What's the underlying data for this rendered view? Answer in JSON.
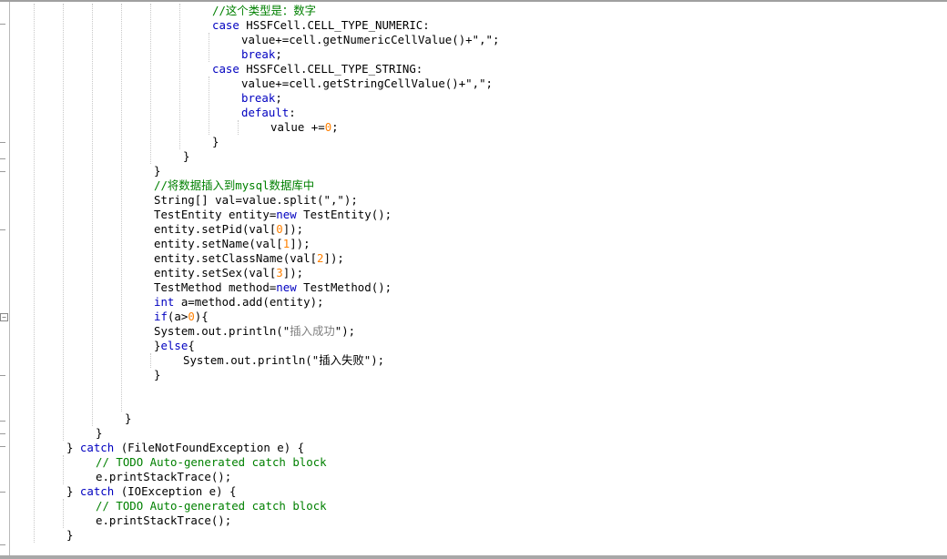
{
  "editor": {
    "lines": [
      {
        "indent": 7,
        "tokens": [
          {
            "t": "//这个类型是：数字",
            "c": "cm"
          }
        ]
      },
      {
        "indent": 7,
        "tokens": [
          {
            "t": "case",
            "c": "kw"
          },
          {
            "t": " HSSFCell.CELL_TYPE_NUMERIC:",
            "c": ""
          }
        ]
      },
      {
        "indent": 8,
        "tokens": [
          {
            "t": "value+=cell.getNumericCellValue()+\",\";",
            "c": ""
          }
        ]
      },
      {
        "indent": 8,
        "tokens": [
          {
            "t": "break",
            "c": "kw"
          },
          {
            "t": ";",
            "c": ""
          }
        ]
      },
      {
        "indent": 7,
        "tokens": [
          {
            "t": "case",
            "c": "kw"
          },
          {
            "t": " HSSFCell.CELL_TYPE_STRING:",
            "c": ""
          }
        ]
      },
      {
        "indent": 8,
        "tokens": [
          {
            "t": "value+=cell.getStringCellValue()+\",\";",
            "c": ""
          }
        ]
      },
      {
        "indent": 8,
        "tokens": [
          {
            "t": "break",
            "c": "kw"
          },
          {
            "t": ";",
            "c": ""
          }
        ]
      },
      {
        "indent": 8,
        "tokens": [
          {
            "t": "default",
            "c": "kw"
          },
          {
            "t": ":",
            "c": ""
          }
        ]
      },
      {
        "indent": 9,
        "tokens": [
          {
            "t": "value +=",
            "c": ""
          },
          {
            "t": "0",
            "c": "num"
          },
          {
            "t": ";",
            "c": ""
          }
        ]
      },
      {
        "indent": 7,
        "tokens": [
          {
            "t": "}",
            "c": ""
          }
        ]
      },
      {
        "indent": 6,
        "tokens": [
          {
            "t": "}",
            "c": ""
          }
        ]
      },
      {
        "indent": 5,
        "tokens": [
          {
            "t": "}",
            "c": ""
          }
        ]
      },
      {
        "indent": 5,
        "tokens": [
          {
            "t": "//将数据插入到mysql数据库中",
            "c": "cm"
          }
        ]
      },
      {
        "indent": 5,
        "tokens": [
          {
            "t": "String[] val=value.split(\",\");",
            "c": ""
          }
        ]
      },
      {
        "indent": 5,
        "tokens": [
          {
            "t": "TestEntity entity=",
            "c": ""
          },
          {
            "t": "new",
            "c": "kw"
          },
          {
            "t": " TestEntity();",
            "c": ""
          }
        ]
      },
      {
        "indent": 5,
        "tokens": [
          {
            "t": "entity.setPid(val[",
            "c": ""
          },
          {
            "t": "0",
            "c": "num"
          },
          {
            "t": "]);",
            "c": ""
          }
        ]
      },
      {
        "indent": 5,
        "tokens": [
          {
            "t": "entity.setName(val[",
            "c": ""
          },
          {
            "t": "1",
            "c": "num"
          },
          {
            "t": "]);",
            "c": ""
          }
        ]
      },
      {
        "indent": 5,
        "tokens": [
          {
            "t": "entity.setClassName(val[",
            "c": ""
          },
          {
            "t": "2",
            "c": "num"
          },
          {
            "t": "]);",
            "c": ""
          }
        ]
      },
      {
        "indent": 5,
        "tokens": [
          {
            "t": "entity.setSex(val[",
            "c": ""
          },
          {
            "t": "3",
            "c": "num"
          },
          {
            "t": "]);",
            "c": ""
          }
        ]
      },
      {
        "indent": 5,
        "tokens": [
          {
            "t": "TestMethod method=",
            "c": ""
          },
          {
            "t": "new",
            "c": "kw"
          },
          {
            "t": " TestMethod();",
            "c": ""
          }
        ]
      },
      {
        "indent": 5,
        "tokens": [
          {
            "t": "int",
            "c": "kw"
          },
          {
            "t": " a=method.add(entity);",
            "c": ""
          }
        ]
      },
      {
        "indent": 5,
        "tokens": [
          {
            "t": "if",
            "c": "kw"
          },
          {
            "t": "(a>",
            "c": ""
          },
          {
            "t": "0",
            "c": "num"
          },
          {
            "t": "){",
            "c": ""
          }
        ]
      },
      {
        "indent": 5,
        "tokens": [
          {
            "t": "System.out.println(\"",
            "c": ""
          },
          {
            "t": "插入成功",
            "c": "str"
          },
          {
            "t": "\");",
            "c": ""
          }
        ]
      },
      {
        "indent": 5,
        "tokens": [
          {
            "t": "}",
            "c": ""
          },
          {
            "t": "else",
            "c": "kw"
          },
          {
            "t": "{",
            "c": ""
          }
        ]
      },
      {
        "indent": 6,
        "tokens": [
          {
            "t": "System.out.println(\"插入失败\");",
            "c": ""
          }
        ]
      },
      {
        "indent": 5,
        "tokens": [
          {
            "t": "}",
            "c": ""
          }
        ]
      },
      {
        "indent": 0,
        "tokens": []
      },
      {
        "indent": 0,
        "tokens": []
      },
      {
        "indent": 4,
        "tokens": [
          {
            "t": "}",
            "c": ""
          }
        ]
      },
      {
        "indent": 3,
        "tokens": [
          {
            "t": "}",
            "c": ""
          }
        ]
      },
      {
        "indent": 2,
        "tokens": [
          {
            "t": "} ",
            "c": ""
          },
          {
            "t": "catch",
            "c": "kw"
          },
          {
            "t": " (FileNotFoundException e) {",
            "c": ""
          }
        ]
      },
      {
        "indent": 3,
        "tokens": [
          {
            "t": "// TODO Auto-generated catch block",
            "c": "cm"
          }
        ]
      },
      {
        "indent": 3,
        "tokens": [
          {
            "t": "e.printStackTrace();",
            "c": ""
          }
        ]
      },
      {
        "indent": 2,
        "tokens": [
          {
            "t": "} ",
            "c": ""
          },
          {
            "t": "catch",
            "c": "kw"
          },
          {
            "t": " (IOException e) {",
            "c": ""
          }
        ]
      },
      {
        "indent": 3,
        "tokens": [
          {
            "t": "// TODO Auto-generated catch block",
            "c": "cm"
          }
        ]
      },
      {
        "indent": 3,
        "tokens": [
          {
            "t": "e.printStackTrace();",
            "c": ""
          }
        ]
      },
      {
        "indent": 2,
        "tokens": [
          {
            "t": "}",
            "c": ""
          }
        ]
      }
    ]
  }
}
